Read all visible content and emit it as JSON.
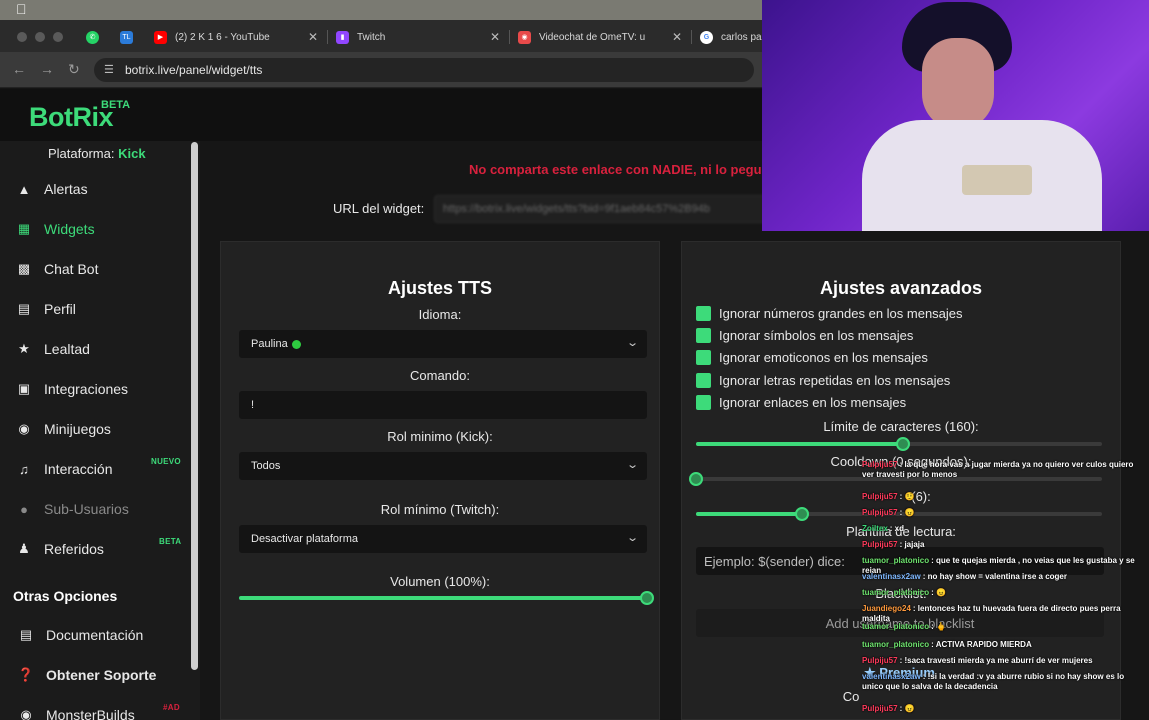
{
  "browser": {
    "tabs": [
      {
        "title": "",
        "icon": "whatsapp-icon",
        "color": "#25d366"
      },
      {
        "title": "",
        "icon": "tl-icon",
        "color": "#2b7bd9"
      },
      {
        "title": "(2) 2 K 1 6 - YouTube",
        "icon": "youtube-icon",
        "color": "#ff0000"
      },
      {
        "title": "Twitch",
        "icon": "twitch-icon",
        "color": "#9146ff"
      },
      {
        "title": "Videochat de OmeTV: u",
        "icon": "ometv-icon",
        "color": "#ff4a4a"
      },
      {
        "title": "carlos pal",
        "icon": "google-icon",
        "color": "#4285f4"
      }
    ],
    "url": "botrix.live/panel/widget/tts"
  },
  "app": {
    "logo": "BotRix",
    "logo_badge": "BETA"
  },
  "sidebar": {
    "platform_label": "Plataforma:",
    "platform_value": "Kick",
    "items": [
      {
        "label": "Alertas",
        "icon": "warning-icon",
        "state": "normal",
        "badge": ""
      },
      {
        "label": "Widgets",
        "icon": "grid-icon",
        "state": "active",
        "badge": ""
      },
      {
        "label": "Chat Bot",
        "icon": "robot-icon",
        "state": "normal",
        "badge": ""
      },
      {
        "label": "Perfil",
        "icon": "id-card-icon",
        "state": "normal",
        "badge": ""
      },
      {
        "label": "Lealtad",
        "icon": "trophy-icon",
        "state": "normal",
        "badge": ""
      },
      {
        "label": "Integraciones",
        "icon": "plug-icon",
        "state": "normal",
        "badge": ""
      },
      {
        "label": "Minijuegos",
        "icon": "gamepad-icon",
        "state": "normal",
        "badge": ""
      },
      {
        "label": "Interacción",
        "icon": "music-icon",
        "state": "normal",
        "badge": "NUEVO"
      },
      {
        "label": "Sub-Usuarios",
        "icon": "users-icon",
        "state": "disabled",
        "badge": ""
      },
      {
        "label": "Referidos",
        "icon": "people-icon",
        "state": "normal",
        "badge": "BETA"
      }
    ],
    "other_title": "Otras Opciones",
    "other_items": [
      {
        "label": "Documentación",
        "icon": "book-icon",
        "badge": ""
      },
      {
        "label": "Obtener Soporte",
        "icon": "help-icon",
        "badge": ""
      },
      {
        "label": "MonsterBuilds",
        "icon": "monster-icon",
        "badge": "#AD"
      }
    ]
  },
  "main": {
    "warning": "No comparta este enlace con NADIE, ni lo pegue",
    "widget_url_label": "URL del widget:",
    "widget_url_value": "https://botrix.live/widgets/tts?bid=9f1aeb84c57%2B94b",
    "tts": {
      "title": "Ajustes TTS",
      "language_label": "Idioma:",
      "language_value": "Paulina",
      "command_label": "Comando:",
      "command_value": "!",
      "kick_role_label": "Rol minimo (Kick):",
      "kick_role_value": "Todos",
      "twitch_role_label": "Rol mínimo (Twitch):",
      "twitch_role_value": "Desactivar plataforma",
      "volume_label": "Volumen (100%):",
      "volume_value": 1.0
    },
    "advanced": {
      "title": "Ajustes avanzados",
      "checks": [
        "Ignorar números grandes en los mensajes",
        "Ignorar símbolos en los mensajes",
        "Ignorar emoticonos en los mensajes",
        "Ignorar letras repetidas en los mensajes",
        "Ignorar enlaces en los mensajes"
      ],
      "char_limit_label": "Límite de caracteres (160):",
      "char_limit_value": 0.51,
      "cooldown_label": "Cooldown (0 segundos):",
      "cooldown_value": 0.0,
      "third_label": "(6):",
      "third_value": 0.26,
      "template_label": "Plantilla de lectura:",
      "template_placeholder": "Ejemplo: $(sender) dice:",
      "blacklist_label": "Blacklist:",
      "blacklist_placeholder": "Add username to blacklist",
      "premium_label": "Premium",
      "bottom_label": "Co"
    }
  },
  "chat": [
    {
      "user": "Pulpiju57",
      "color": "#ff3b5c",
      "text": ": la que hora vas a jugar mierda ya no quiero ver culos quiero ver travesti por lo menos"
    },
    {
      "user": "Pulpiju57",
      "color": "#ff3b5c",
      "text": ": 🤨"
    },
    {
      "user": "Pulpiju57",
      "color": "#ff3b5c",
      "text": ": 😠"
    },
    {
      "user": "Zoiltex",
      "color": "#3ddb7a",
      "text": ": xd"
    },
    {
      "user": "Pulpiju57",
      "color": "#ff3b5c",
      "text": ": jajaja"
    },
    {
      "user": "tuamor_platonico",
      "color": "#6fe46f",
      "text": ": que te quejas mierda , no veias que les gustaba y se reian"
    },
    {
      "user": "valentinasx2aw",
      "color": "#7fb8ff",
      "text": ": no hay show = valentina irse a coger"
    },
    {
      "user": "tuamor_platonico",
      "color": "#6fe46f",
      "text": ": 😠"
    },
    {
      "user": "Juandiego24",
      "color": "#ff9a3d",
      "text": ": lentonces haz tu huevada fuera de directo pues perra maldita"
    },
    {
      "user": "tuamor_platonico",
      "color": "#6fe46f",
      "text": ": 🖕"
    },
    {
      "user": "tuamor_platonico",
      "color": "#6fe46f",
      "text": ": ACTIVA RAPIDO MIERDA"
    },
    {
      "user": "Pulpiju57",
      "color": "#ff3b5c",
      "text": ": !saca travesti mierda ya me aburrí de ver mujeres"
    },
    {
      "user": "valentinasx2aw",
      "color": "#7fb8ff",
      "text": ": !si la verdad :v ya aburre rubio si no hay show es lo unico que lo salva de la decadencia"
    },
    {
      "user": "Pulpiju57",
      "color": "#ff3b5c",
      "text": ": 😠"
    }
  ]
}
